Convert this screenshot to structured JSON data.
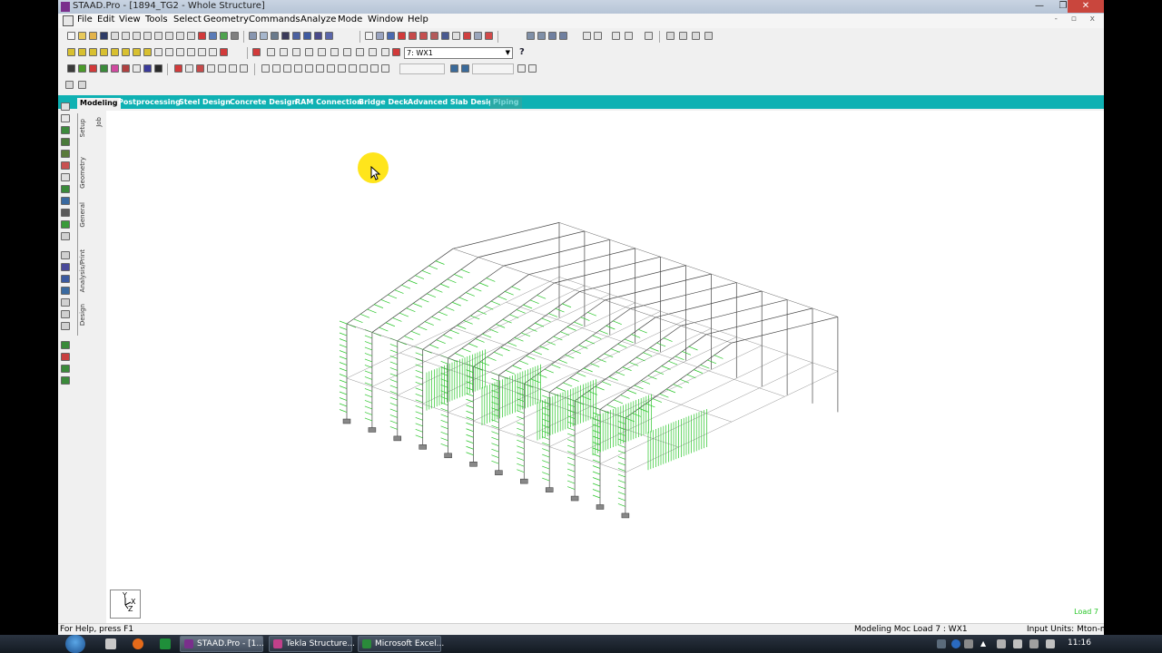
{
  "window": {
    "title": "STAAD.Pro - [1894_TG2 - Whole Structure]",
    "minimize": "—",
    "restore": "❐",
    "close": "✕"
  },
  "menu": {
    "items": [
      "File",
      "Edit",
      "View",
      "Tools",
      "Select",
      "Geometry",
      "Commands",
      "Analyze",
      "Mode",
      "Window",
      "Help"
    ]
  },
  "toolbar": {
    "load_case_selected": "7: WX1",
    "help_symbol": "?"
  },
  "page_control": {
    "tabs": [
      "Modeling",
      "Postprocessing",
      "Steel Design",
      "Concrete Design",
      "RAM Connection",
      "Bridge Deck",
      "Advanced Slab Design",
      "Piping"
    ],
    "active_tab": "Modeling",
    "side_tabs": [
      "Job",
      "Setup",
      "Geometry",
      "General",
      "Analysis/Print",
      "Design"
    ]
  },
  "viewport": {
    "axis_y": "Y",
    "axis_x": "X",
    "axis_z": "Z",
    "load_label": "Load 7",
    "load_color": "#29c629"
  },
  "status": {
    "help": "For Help, press F1",
    "mode": "Modeling Moc Load 7 : WX1",
    "units": "Input Units:  Mton-m"
  },
  "taskbar": {
    "tasks": [
      {
        "label": "STAAD.Pro - [1...",
        "color": "#7a2f8c",
        "active": true
      },
      {
        "label": "Tekla Structure...",
        "color": "#c0408a",
        "active": false
      },
      {
        "label": "Microsoft Excel...",
        "color": "#2a8a3a",
        "active": false
      }
    ],
    "clock": "11:16"
  }
}
